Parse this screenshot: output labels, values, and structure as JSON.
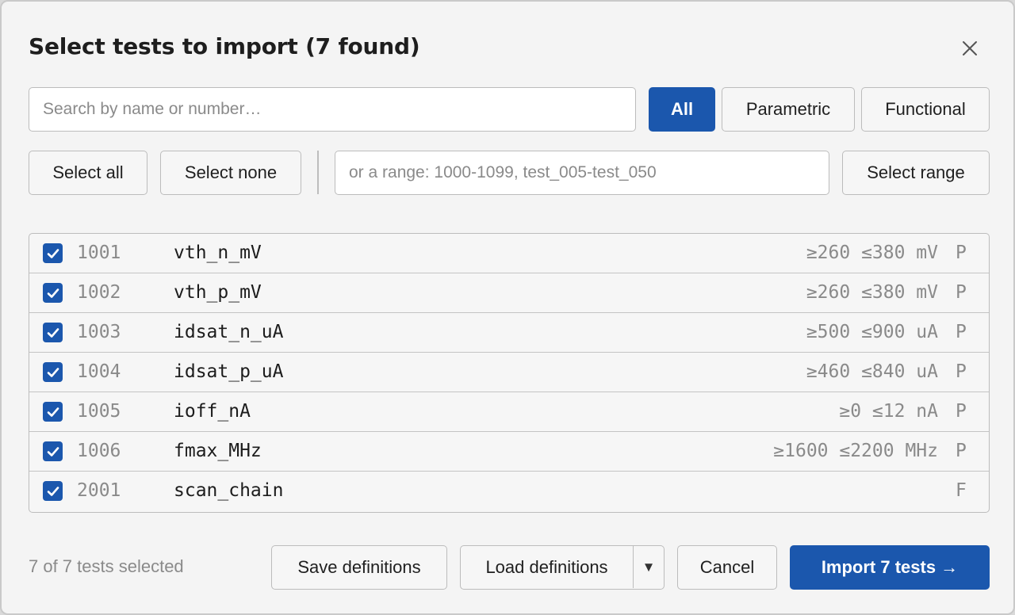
{
  "dialog": {
    "title": "Select tests to import (7 found)"
  },
  "search": {
    "placeholder": "Search by name or number…"
  },
  "filters": {
    "all_label": "All",
    "parametric_label": "Parametric",
    "functional_label": "Functional",
    "active": "All"
  },
  "selection": {
    "select_all_label": "Select all",
    "select_none_label": "Select none",
    "range_placeholder": "or a range: 1000-1099, test_005-test_050",
    "select_range_label": "Select range"
  },
  "tests": [
    {
      "checked": true,
      "number": "1001",
      "name": "vth_n_mV",
      "limits": "≥260 ≤380 mV",
      "kind": "P"
    },
    {
      "checked": true,
      "number": "1002",
      "name": "vth_p_mV",
      "limits": "≥260 ≤380 mV",
      "kind": "P"
    },
    {
      "checked": true,
      "number": "1003",
      "name": "idsat_n_uA",
      "limits": "≥500 ≤900 uA",
      "kind": "P"
    },
    {
      "checked": true,
      "number": "1004",
      "name": "idsat_p_uA",
      "limits": "≥460 ≤840 uA",
      "kind": "P"
    },
    {
      "checked": true,
      "number": "1005",
      "name": "ioff_nA",
      "limits": "≥0 ≤12 nA",
      "kind": "P"
    },
    {
      "checked": true,
      "number": "1006",
      "name": "fmax_MHz",
      "limits": "≥1600 ≤2200 MHz",
      "kind": "P"
    },
    {
      "checked": true,
      "number": "2001",
      "name": "scan_chain",
      "limits": "",
      "kind": "F"
    }
  ],
  "footer": {
    "status": "7 of 7 tests selected",
    "save_label": "Save definitions",
    "load_label": "Load definitions",
    "cancel_label": "Cancel",
    "import_label": "Import 7 tests →"
  },
  "colors": {
    "accent": "#1b57ad",
    "muted_text": "#8a8a8a"
  },
  "icons": {
    "close": "close-icon",
    "checkbox": "checkmark-icon",
    "dropdown": "caret-down-icon"
  }
}
